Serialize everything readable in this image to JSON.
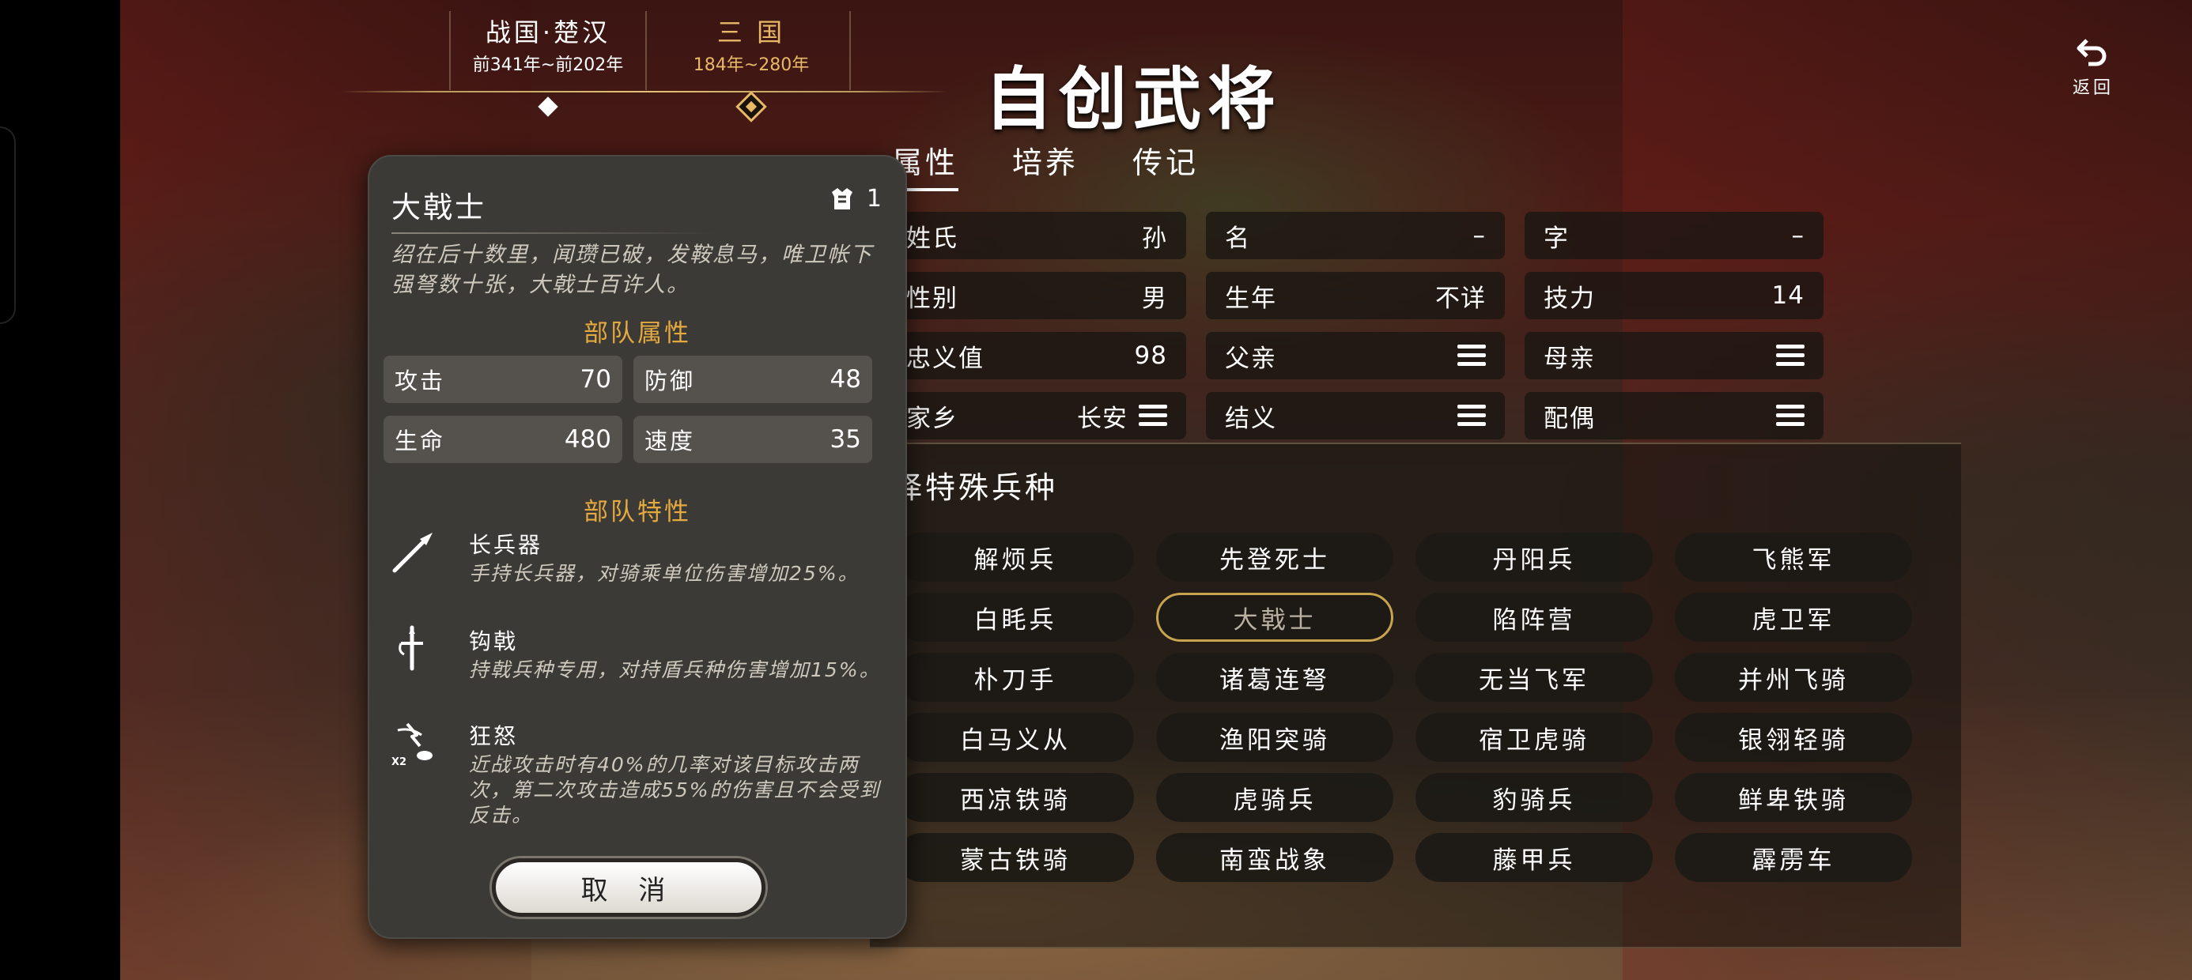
{
  "header": {
    "eras": [
      {
        "name": "战国·楚汉",
        "years": "前341年~前202年"
      },
      {
        "name": "三 国",
        "years": "184年~280年"
      }
    ],
    "page_title": "自创武将",
    "back_label": "返回"
  },
  "tabs": [
    {
      "label": "属性"
    },
    {
      "label": "培养"
    },
    {
      "label": "传记"
    }
  ],
  "attributes": {
    "surname": {
      "label": "姓氏",
      "value": "孙"
    },
    "given_name": {
      "label": "名",
      "value": "–"
    },
    "courtesy_name": {
      "label": "字",
      "value": "–"
    },
    "gender": {
      "label": "性别",
      "value": "男"
    },
    "birth_year": {
      "label": "生年",
      "value": "不详"
    },
    "skill_points": {
      "label": "技力",
      "value": "14"
    },
    "loyalty": {
      "label": "忠义值",
      "value": "98"
    },
    "father": {
      "label": "父亲"
    },
    "mother": {
      "label": "母亲"
    },
    "hometown": {
      "label": "家乡",
      "value": "长安"
    },
    "sworn": {
      "label": "结义"
    },
    "spouse": {
      "label": "配偶"
    }
  },
  "troop_select": {
    "heading": "择特殊兵种",
    "options": [
      "解烦兵",
      "先登死士",
      "丹阳兵",
      "飞熊军",
      "白眊兵",
      "大戟士",
      "陷阵营",
      "虎卫军",
      "朴刀手",
      "诸葛连弩",
      "无当飞军",
      "并州飞骑",
      "白马义从",
      "渔阳突骑",
      "宿卫虎骑",
      "银翎轻骑",
      "西凉铁骑",
      "虎骑兵",
      "豹骑兵",
      "鲜卑铁骑",
      "蒙古铁骑",
      "南蛮战象",
      "藤甲兵",
      "霹雳车"
    ],
    "selected": "大戟士"
  },
  "modal": {
    "title": "大戟士",
    "count": "1",
    "description": "绍在后十数里，闻瓒已破，发鞍息马，唯卫帐下强弩数十张，大戟士百许人。",
    "stats_heading": "部队属性",
    "stats": {
      "attack": {
        "label": "攻击",
        "value": "70"
      },
      "defense": {
        "label": "防御",
        "value": "48"
      },
      "hp": {
        "label": "生命",
        "value": "480"
      },
      "speed": {
        "label": "速度",
        "value": "35"
      }
    },
    "traits_heading": "部队特性",
    "traits": [
      {
        "icon": "spear-icon",
        "name": "长兵器",
        "desc": "手持长兵器，对骑乘单位伤害增加25%。"
      },
      {
        "icon": "halberd-icon",
        "name": "钩戟",
        "desc": "持戟兵种专用，对持盾兵种伤害增加15%。"
      },
      {
        "icon": "frenzy-icon",
        "name": "狂怒",
        "icon_text": "X2",
        "desc": "近战攻击时有40%的几率对该目标攻击两次，第二次攻击造成55%的伤害且不会受到反击。"
      }
    ],
    "cancel_label": "取 消"
  }
}
